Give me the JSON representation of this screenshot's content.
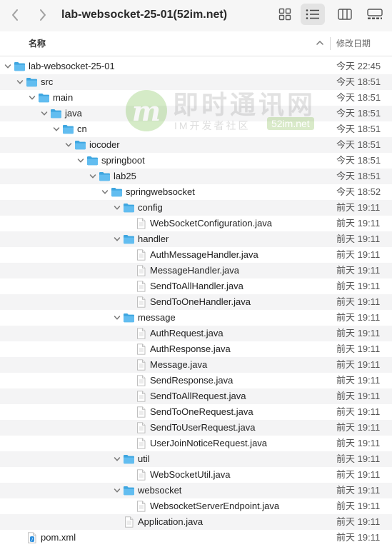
{
  "window": {
    "title": "lab-websocket-25-01(52im.net)"
  },
  "columns": {
    "name": "名称",
    "date_modified": "修改日期"
  },
  "watermark": {
    "logo_letter": "m",
    "title": "即时通讯网",
    "subtitle": "IM开发者社区",
    "url": "52im.net"
  },
  "colors": {
    "folder": "#4fb3e8",
    "row_alt": "#f4f4f5",
    "toolbar": "#f6f6f6"
  },
  "files": [
    {
      "name": "lab-websocket-25-01",
      "date": "今天 22:45",
      "type": "folder",
      "depth": 0,
      "expanded": true
    },
    {
      "name": "src",
      "date": "今天 18:51",
      "type": "folder",
      "depth": 1,
      "expanded": true
    },
    {
      "name": "main",
      "date": "今天 18:51",
      "type": "folder",
      "depth": 2,
      "expanded": true
    },
    {
      "name": "java",
      "date": "今天 18:51",
      "type": "folder",
      "depth": 3,
      "expanded": true
    },
    {
      "name": "cn",
      "date": "今天 18:51",
      "type": "folder",
      "depth": 4,
      "expanded": true
    },
    {
      "name": "iocoder",
      "date": "今天 18:51",
      "type": "folder",
      "depth": 5,
      "expanded": true
    },
    {
      "name": "springboot",
      "date": "今天 18:51",
      "type": "folder",
      "depth": 6,
      "expanded": true
    },
    {
      "name": "lab25",
      "date": "今天 18:51",
      "type": "folder",
      "depth": 7,
      "expanded": true
    },
    {
      "name": "springwebsocket",
      "date": "今天 18:52",
      "type": "folder",
      "depth": 8,
      "expanded": true
    },
    {
      "name": "config",
      "date": "前天 19:11",
      "type": "folder",
      "depth": 9,
      "expanded": true
    },
    {
      "name": "WebSocketConfiguration.java",
      "date": "前天 19:11",
      "type": "file",
      "depth": 10
    },
    {
      "name": "handler",
      "date": "前天 19:11",
      "type": "folder",
      "depth": 9,
      "expanded": true
    },
    {
      "name": "AuthMessageHandler.java",
      "date": "前天 19:11",
      "type": "file",
      "depth": 10
    },
    {
      "name": "MessageHandler.java",
      "date": "前天 19:11",
      "type": "file",
      "depth": 10
    },
    {
      "name": "SendToAllHandler.java",
      "date": "前天 19:11",
      "type": "file",
      "depth": 10
    },
    {
      "name": "SendToOneHandler.java",
      "date": "前天 19:11",
      "type": "file",
      "depth": 10
    },
    {
      "name": "message",
      "date": "前天 19:11",
      "type": "folder",
      "depth": 9,
      "expanded": true
    },
    {
      "name": "AuthRequest.java",
      "date": "前天 19:11",
      "type": "file",
      "depth": 10
    },
    {
      "name": "AuthResponse.java",
      "date": "前天 19:11",
      "type": "file",
      "depth": 10
    },
    {
      "name": "Message.java",
      "date": "前天 19:11",
      "type": "file",
      "depth": 10
    },
    {
      "name": "SendResponse.java",
      "date": "前天 19:11",
      "type": "file",
      "depth": 10
    },
    {
      "name": "SendToAllRequest.java",
      "date": "前天 19:11",
      "type": "file",
      "depth": 10
    },
    {
      "name": "SendToOneRequest.java",
      "date": "前天 19:11",
      "type": "file",
      "depth": 10
    },
    {
      "name": "SendToUserRequest.java",
      "date": "前天 19:11",
      "type": "file",
      "depth": 10
    },
    {
      "name": "UserJoinNoticeRequest.java",
      "date": "前天 19:11",
      "type": "file",
      "depth": 10
    },
    {
      "name": "util",
      "date": "前天 19:11",
      "type": "folder",
      "depth": 9,
      "expanded": true
    },
    {
      "name": "WebSocketUtil.java",
      "date": "前天 19:11",
      "type": "file",
      "depth": 10
    },
    {
      "name": "websocket",
      "date": "前天 19:11",
      "type": "folder",
      "depth": 9,
      "expanded": true
    },
    {
      "name": "WebsocketServerEndpoint.java",
      "date": "前天 19:11",
      "type": "file",
      "depth": 10
    },
    {
      "name": "Application.java",
      "date": "前天 19:11",
      "type": "file",
      "depth": 9
    },
    {
      "name": "pom.xml",
      "date": "前天 19:11",
      "type": "xml",
      "depth": 1
    }
  ]
}
